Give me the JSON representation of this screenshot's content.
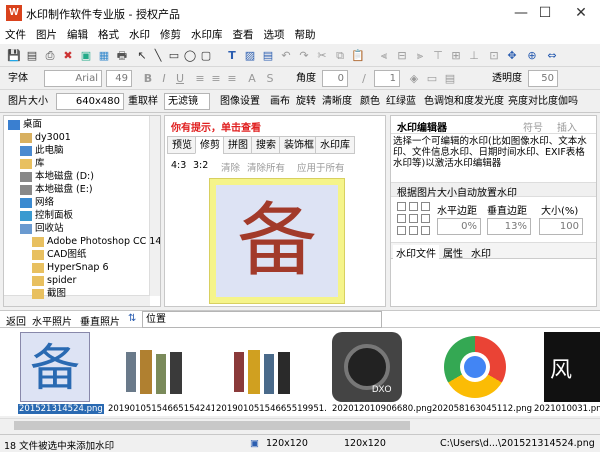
{
  "window": {
    "title": "水印制作软件专业版 - 授权产品",
    "logo": "W",
    "minimize": "—",
    "maximize": "☐",
    "close": "✕"
  },
  "menu": [
    "文件",
    "图片",
    "编辑",
    "格式",
    "水印",
    "修剪",
    "水印库",
    "查看",
    "选项",
    "帮助"
  ],
  "toolbar2": {
    "font_label": "字体",
    "font_value": "Arial",
    "size_value": "49",
    "angle_label": "角度",
    "angle_value": "0",
    "stroke_value": "1",
    "transparency_label": "透明度",
    "transparency_value": "50"
  },
  "toolbar3": {
    "size_label": "图片大小",
    "size_value": "640x480",
    "resample_label": "重取样",
    "filter_value": "无滤镜",
    "items": [
      "图像设置",
      "画布",
      "旋转",
      "清晰度",
      "颜色",
      "红绿蓝",
      "色调饱和度发光度",
      "亮度对比度伽吗"
    ]
  },
  "tree": [
    {
      "label": "桌面",
      "indent": 0,
      "icon": "folder-blue"
    },
    {
      "label": "dy3001",
      "indent": 1,
      "icon": "user"
    },
    {
      "label": "此电脑",
      "indent": 1,
      "icon": "pc"
    },
    {
      "label": "库",
      "indent": 1,
      "icon": "folder"
    },
    {
      "label": "本地磁盘 (D:)",
      "indent": 1,
      "icon": "disk"
    },
    {
      "label": "本地磁盘 (E:)",
      "indent": 1,
      "icon": "disk"
    },
    {
      "label": "网络",
      "indent": 1,
      "icon": "network"
    },
    {
      "label": "控制面板",
      "indent": 1,
      "icon": "panel"
    },
    {
      "label": "回收站",
      "indent": 1,
      "icon": "bin"
    },
    {
      "label": "Adobe Photoshop CC 14.0 多",
      "indent": 2,
      "icon": "folder"
    },
    {
      "label": "CAD图纸",
      "indent": 2,
      "icon": "folder"
    },
    {
      "label": "HyperSnap 6",
      "indent": 2,
      "icon": "folder"
    },
    {
      "label": "spider",
      "indent": 2,
      "icon": "folder"
    },
    {
      "label": "截图",
      "indent": 2,
      "icon": "folder"
    }
  ],
  "mid": {
    "hint": "你有提示，单击查看",
    "tabs": [
      "预览",
      "修剪",
      "拼图",
      "搜索",
      "装饰框",
      "水印库"
    ],
    "ratio1": "4:3",
    "ratio2": "3:2",
    "clear": "清除",
    "clear_all": "清除所有",
    "apply_all": "应用于所有",
    "preview_char": "备"
  },
  "editor": {
    "title": "水印编辑器",
    "symbol": "符号",
    "insert": "插入",
    "desc": "选择一个可编辑的水印(比如图像水印、文本水印、文件信息水印、日期时间水印、EXIF表格水印等)以激活水印编辑器",
    "auto_title": "根据图片大小自动放置水印",
    "h_margin_label": "水平边距",
    "v_margin_label": "垂直边距",
    "size_label": "大小(%)",
    "h_margin": "0%",
    "v_margin": "13%",
    "size": "100",
    "tabs": [
      "水印文件",
      "属性",
      "水印"
    ]
  },
  "bottombar": {
    "back": "返回",
    "h_photo": "水平照片",
    "v_photo": "垂直照片",
    "position": "位置"
  },
  "thumbs": [
    "201521314524.png",
    "20190105154665154241.jpg",
    "20190105154665519951.jpg",
    "202012010906680.png",
    "202058163045112.png",
    "2021010031.png"
  ],
  "status": {
    "count": "18 文件被选中来添加水印",
    "dim1": "120x120",
    "dim2": "120x120",
    "path": "C:\\Users\\d...\\201521314524.png"
  }
}
